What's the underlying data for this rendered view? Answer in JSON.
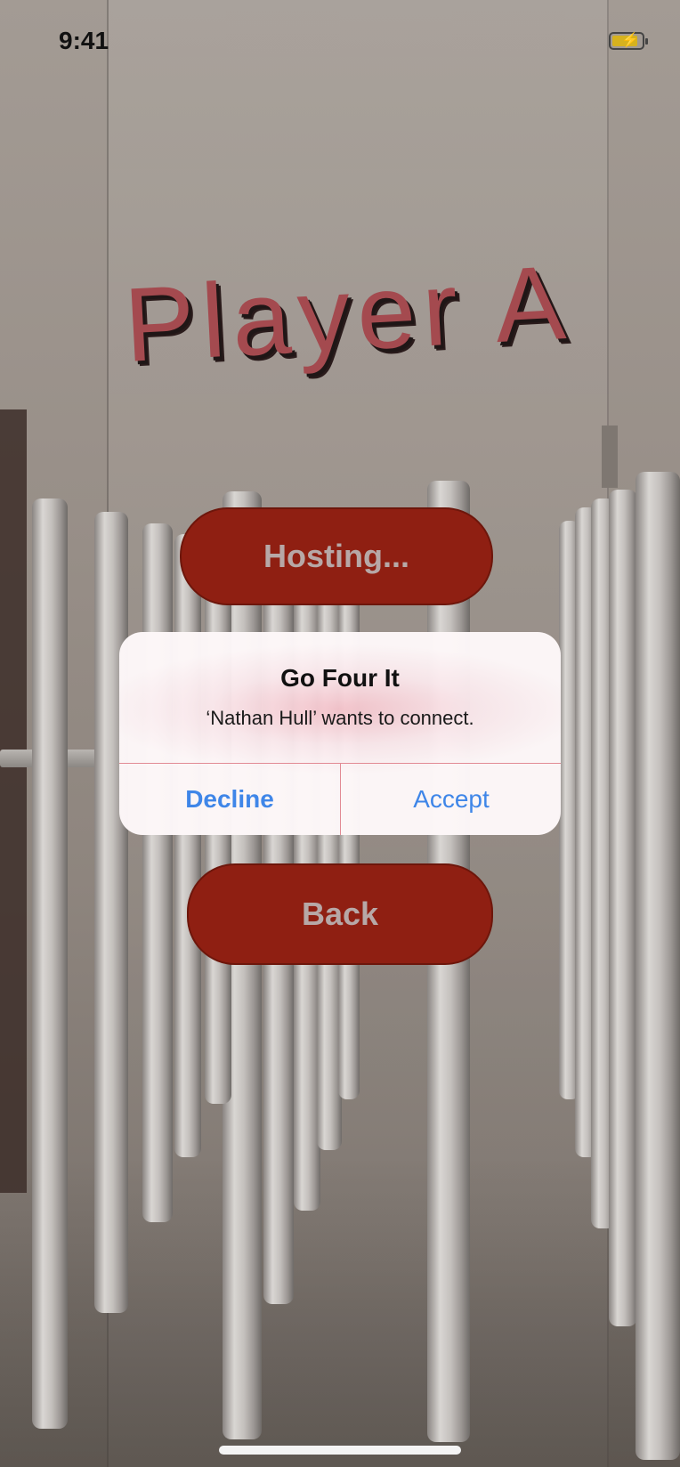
{
  "status_bar": {
    "time": "9:41",
    "battery_icon": "battery-charging-icon"
  },
  "scene": {
    "title": "Player A",
    "title_color": "#a44a4f"
  },
  "buttons": {
    "hosting_label": "Hosting...",
    "back_label": "Back",
    "button_color": "#8f1f12"
  },
  "alert": {
    "title": "Go Four It",
    "message": "‘Nathan Hull’ wants to connect.",
    "decline_label": "Decline",
    "accept_label": "Accept",
    "action_color": "#3f86e8"
  }
}
